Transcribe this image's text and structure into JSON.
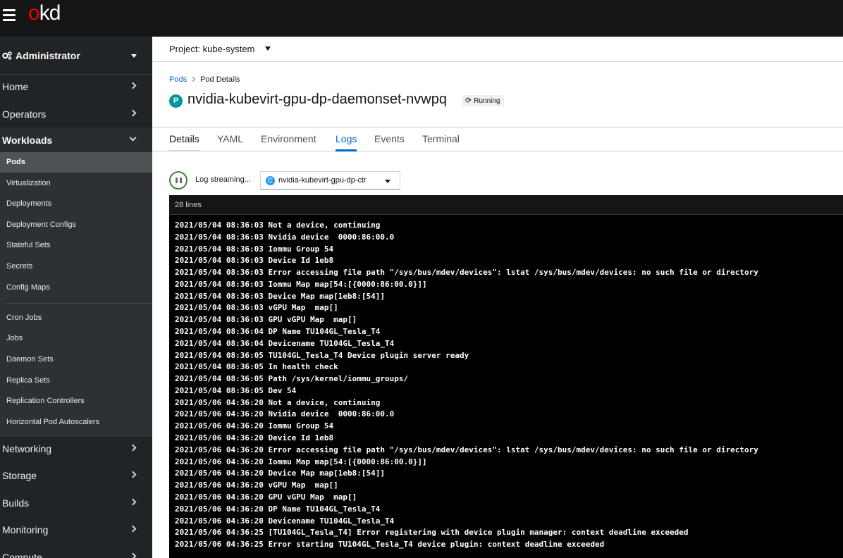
{
  "app": {
    "logo_text_prefix": "o",
    "logo_text_rest": "kd"
  },
  "perspective": {
    "label": "Administrator"
  },
  "nav": {
    "sections": [
      {
        "label": "Home"
      },
      {
        "label": "Operators"
      },
      {
        "label": "Workloads"
      },
      {
        "label": "Networking"
      },
      {
        "label": "Storage"
      },
      {
        "label": "Builds"
      },
      {
        "label": "Monitoring"
      },
      {
        "label": "Compute"
      }
    ],
    "workloads_items": [
      {
        "label": "Pods"
      },
      {
        "label": "Virtualization"
      },
      {
        "label": "Deployments"
      },
      {
        "label": "Deployment Configs"
      },
      {
        "label": "Stateful Sets"
      },
      {
        "label": "Secrets"
      },
      {
        "label": "Config Maps"
      },
      {
        "label": "Cron Jobs"
      },
      {
        "label": "Jobs"
      },
      {
        "label": "Daemon Sets"
      },
      {
        "label": "Replica Sets"
      },
      {
        "label": "Replication Controllers"
      },
      {
        "label": "Horizontal Pod Autoscalers"
      }
    ]
  },
  "project": {
    "label": "Project: kube-system"
  },
  "breadcrumb": {
    "parent": "Pods",
    "current": "Pod Details"
  },
  "pod": {
    "badge": "P",
    "name": "nvidia-kubevirt-gpu-dp-daemonset-nvwpq",
    "status": "Running"
  },
  "tabs": [
    {
      "label": "Details"
    },
    {
      "label": "YAML"
    },
    {
      "label": "Environment"
    },
    {
      "label": "Logs"
    },
    {
      "label": "Events"
    },
    {
      "label": "Terminal"
    }
  ],
  "logs": {
    "streaming_label": "Log streaming...",
    "container_badge": "C",
    "container": "nvidia-kubevirt-gpu-dp-ctr",
    "line_count": "28 lines",
    "lines": [
      "2021/05/04 08:36:03 Not a device, continuing",
      "2021/05/04 08:36:03 Nvidia device  0000:86:00.0",
      "2021/05/04 08:36:03 Iommu Group 54",
      "2021/05/04 08:36:03 Device Id 1eb8",
      "2021/05/04 08:36:03 Error accessing file path \"/sys/bus/mdev/devices\": lstat /sys/bus/mdev/devices: no such file or directory",
      "2021/05/04 08:36:03 Iommu Map map[54:[{0000:86:00.0}]]",
      "2021/05/04 08:36:03 Device Map map[1eb8:[54]]",
      "2021/05/04 08:36:03 vGPU Map  map[]",
      "2021/05/04 08:36:03 GPU vGPU Map  map[]",
      "2021/05/04 08:36:04 DP Name TU104GL_Tesla_T4",
      "2021/05/04 08:36:04 Devicename TU104GL_Tesla_T4",
      "2021/05/04 08:36:05 TU104GL_Tesla_T4 Device plugin server ready",
      "2021/05/04 08:36:05 In health check",
      "2021/05/04 08:36:05 Path /sys/kernel/iommu_groups/",
      "2021/05/04 08:36:05 Dev 54",
      "2021/05/06 04:36:20 Not a device, continuing",
      "2021/05/06 04:36:20 Nvidia device  0000:86:00.0",
      "2021/05/06 04:36:20 Iommu Group 54",
      "2021/05/06 04:36:20 Device Id 1eb8",
      "2021/05/06 04:36:20 Error accessing file path \"/sys/bus/mdev/devices\": lstat /sys/bus/mdev/devices: no such file or directory",
      "2021/05/06 04:36:20 Iommu Map map[54:[{0000:86:00.0}]]",
      "2021/05/06 04:36:20 Device Map map[1eb8:[54]]",
      "2021/05/06 04:36:20 vGPU Map  map[]",
      "2021/05/06 04:36:20 GPU vGPU Map  map[]",
      "2021/05/06 04:36:20 DP Name TU104GL_Tesla_T4",
      "2021/05/06 04:36:20 Devicename TU104GL_Tesla_T4",
      "2021/05/06 04:36:25 [TU104GL_Tesla_T4] Error registering with device plugin manager: context deadline exceeded",
      "2021/05/06 04:36:25 Error starting TU104GL_Tesla_T4 device plugin: context deadline exceeded"
    ]
  }
}
